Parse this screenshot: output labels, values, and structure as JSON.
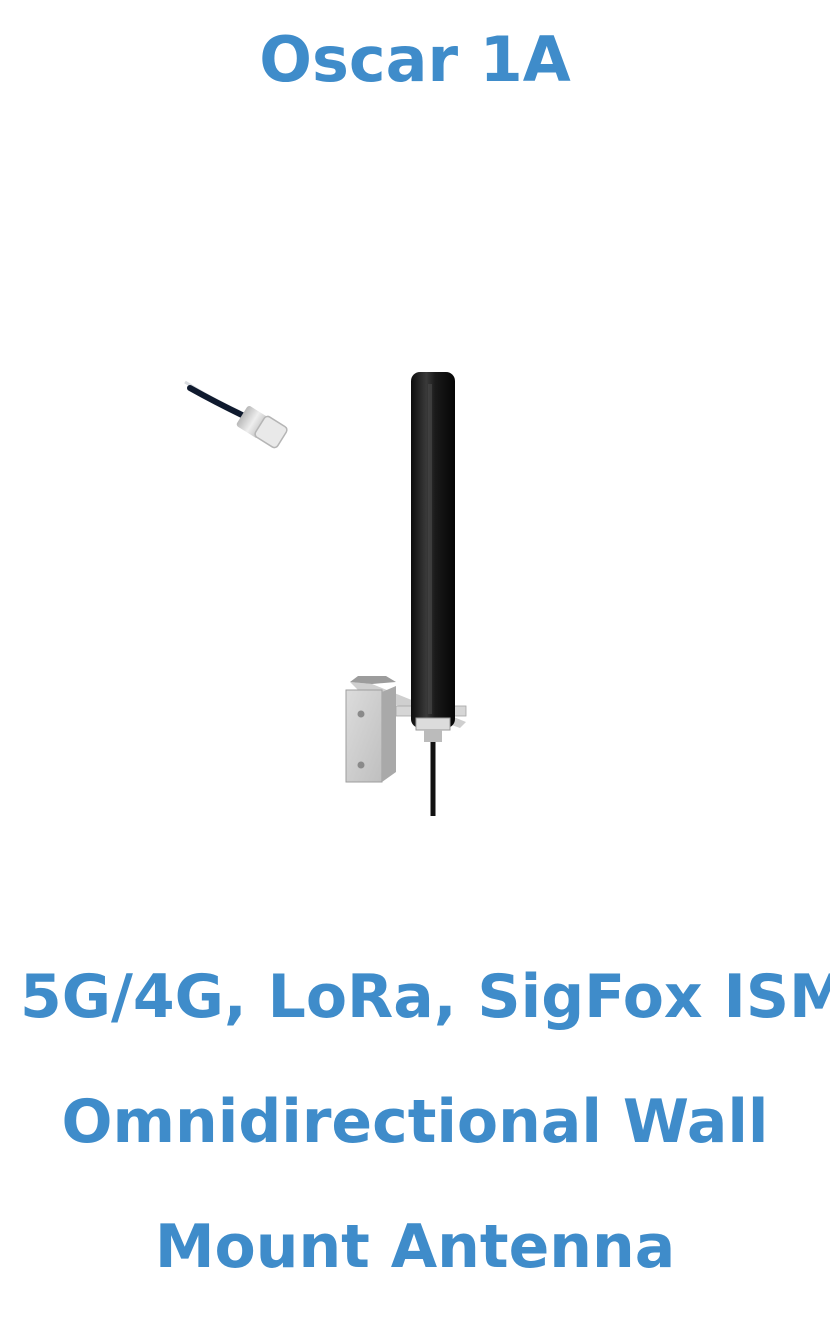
{
  "product": {
    "title": "Oscar 1A",
    "description_lines": [
      "5G/4G, LoRa, SigFox ISM",
      "Omnidirectional Wall",
      "Mount Antenna"
    ],
    "image_icon": "antenna-product-photo"
  },
  "colors": {
    "accent": "#3f8cca",
    "background": "#ffffff"
  }
}
